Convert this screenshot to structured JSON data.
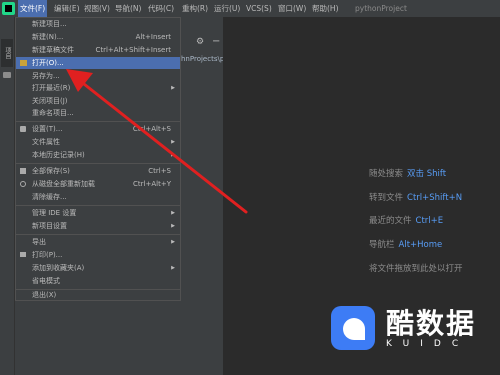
{
  "menubar": {
    "items": [
      "文件(F)",
      "编辑(E)",
      "视图(V)",
      "导航(N)",
      "代码(C)",
      "重构(R)",
      "运行(U)",
      "VCS(S)",
      "窗口(W)",
      "帮助(H)"
    ],
    "project": "pythonProject"
  },
  "side_tab": "项目",
  "project_path": "hnProjects\\p",
  "file_menu": {
    "new_project": "新建项目...",
    "new": "新建(N)...",
    "new_shortcut": "Alt+Insert",
    "new_scratch": "新建草稿文件",
    "new_scratch_shortcut": "Ctrl+Alt+Shift+Insert",
    "open": "打开(O)...",
    "save_as": "另存为...",
    "open_recent": "打开最近(R)",
    "close_project": "关闭项目(J)",
    "rename_project": "重命名项目...",
    "settings": "设置(T)...",
    "settings_shortcut": "Ctrl+Alt+S",
    "file_properties": "文件属性",
    "local_history": "本地历史记录(H)",
    "save_all": "全部保存(S)",
    "save_all_shortcut": "Ctrl+S",
    "reload_all": "从磁盘全部重新加载",
    "reload_all_shortcut": "Ctrl+Alt+Y",
    "invalidate_caches": "清除缓存...",
    "manage_ide_settings": "管理 IDE 设置",
    "new_project_settings": "新项目设置",
    "export": "导出",
    "print": "打印(P)...",
    "add_to_favorites": "添加到收藏夹(A)",
    "power_save": "省电模式",
    "exit": "退出(X)"
  },
  "tips": [
    {
      "text": "随处搜索",
      "key": "双击 Shift"
    },
    {
      "text": "转到文件",
      "key": "Ctrl+Shift+N"
    },
    {
      "text": "最近的文件",
      "key": "Ctrl+E"
    },
    {
      "text": "导航栏",
      "key": "Alt+Home"
    },
    {
      "text": "将文件拖放到此处以打开",
      "key": ""
    }
  ],
  "watermark": {
    "title": "酷数据",
    "subtitle": "KUIDC"
  },
  "colors": {
    "accent": "#4b6eaf",
    "arrow": "#e02020",
    "hint_key": "#589df6"
  }
}
